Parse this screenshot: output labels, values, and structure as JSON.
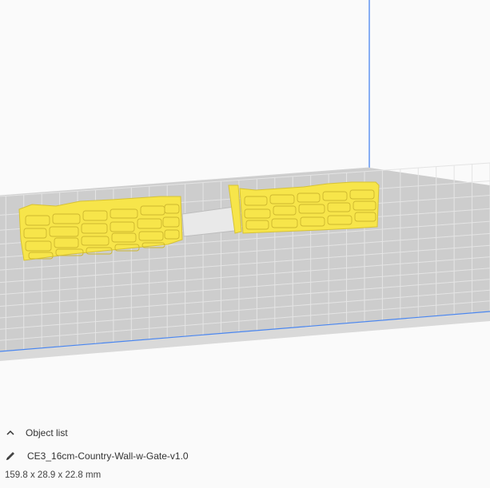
{
  "object_list": {
    "title": "Object list",
    "toggle_icon": "chevron-up-icon",
    "edit_icon": "pencil-icon",
    "file_name": "CE3_16cm-Country-Wall-w-Gate-v1.0",
    "dimensions": "159.8 x 28.9 x 22.8 mm"
  },
  "colors": {
    "background": "#fafafa",
    "build_plate": "#c8c8c8",
    "grid_line": "#e0e0e0",
    "axis_blue": "#3b7cf0",
    "model": "#f7e54a",
    "model_shadow": "#d6c236"
  }
}
